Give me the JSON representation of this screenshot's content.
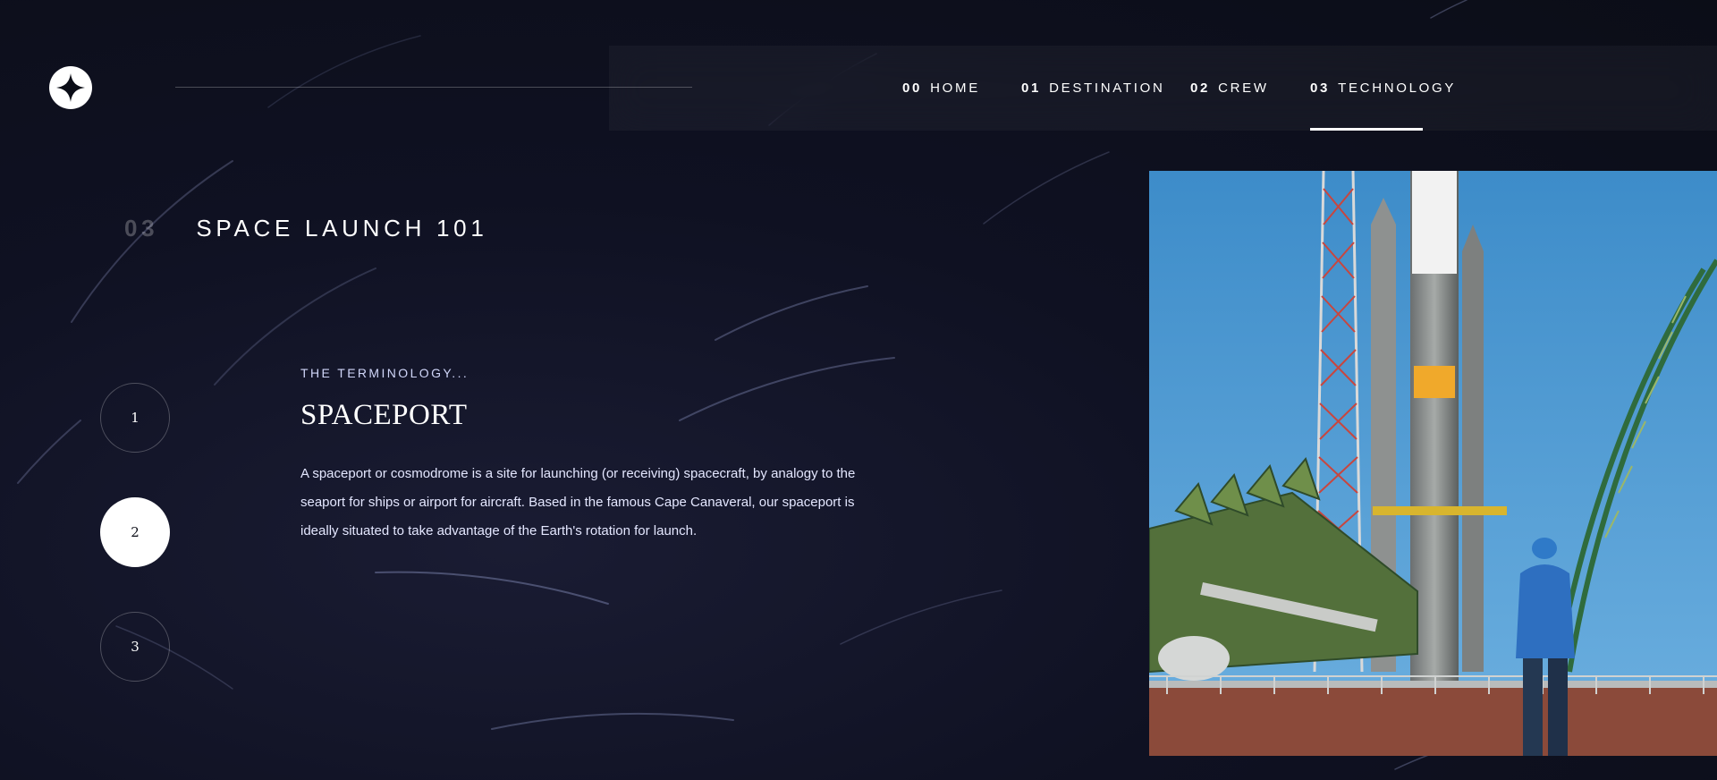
{
  "nav": {
    "items": [
      {
        "num": "00",
        "label": "HOME"
      },
      {
        "num": "01",
        "label": "DESTINATION"
      },
      {
        "num": "02",
        "label": "CREW"
      },
      {
        "num": "03",
        "label": "TECHNOLOGY"
      }
    ],
    "active_index": 3
  },
  "page": {
    "heading_num": "03",
    "heading": "SPACE LAUNCH 101"
  },
  "steps": [
    "1",
    "2",
    "3"
  ],
  "active_step": "2",
  "content": {
    "eyebrow": "THE TERMINOLOGY...",
    "title": "SPACEPORT",
    "description": "A spaceport or cosmodrome is a site for launching (or receiving) spacecraft, by analogy to the seaport for ships or airport for aircraft. Based in the famous Cape Canaveral, our spaceport is ideally situated to take advantage of the Earth's rotation for launch."
  },
  "colors": {
    "background": "#0b0d17",
    "text": "#ffffff",
    "accent": "#d0d6f9",
    "sky": "#4a97cf"
  }
}
